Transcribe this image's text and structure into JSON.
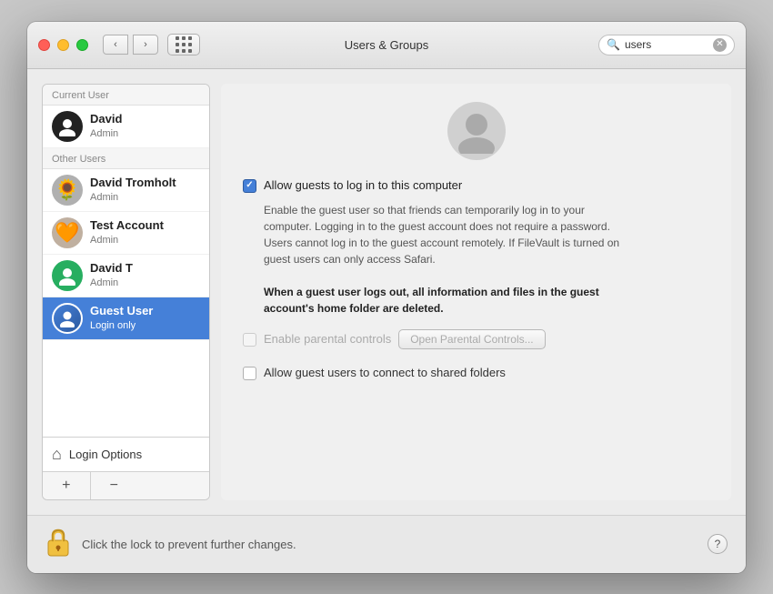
{
  "window": {
    "title": "Users & Groups"
  },
  "titlebar": {
    "back_label": "‹",
    "forward_label": "›",
    "search_value": "users",
    "search_placeholder": "Search"
  },
  "sidebar": {
    "current_user_header": "Current User",
    "other_users_header": "Other Users",
    "current_user": {
      "name": "David",
      "role": "Admin"
    },
    "other_users": [
      {
        "name": "David Tromholt",
        "role": "Admin",
        "avatar_type": "sunflower"
      },
      {
        "name": "Test Account",
        "role": "Admin",
        "avatar_type": "orange"
      },
      {
        "name": "David T",
        "role": "Admin",
        "avatar_type": "green"
      },
      {
        "name": "Guest User",
        "role": "Login only",
        "avatar_type": "guest",
        "selected": true
      }
    ],
    "login_options_label": "Login Options",
    "add_btn": "+",
    "remove_btn": "−"
  },
  "detail": {
    "allow_guests_label": "Allow guests to log in to this computer",
    "description": "Enable the guest user so that friends can temporarily log in to your computer. Logging in to the guest account does not require a password. Users cannot log in to the guest account remotely. If FileVault is turned on guest users can only access Safari.",
    "warning_text": "When a guest user logs out, all information and files in the guest account's home folder are deleted.",
    "parental_controls_label": "Enable parental controls",
    "open_parental_btn_label": "Open Parental Controls...",
    "shared_folders_label": "Allow guest users to connect to shared folders",
    "allow_guests_checked": true,
    "parental_controls_checked": false,
    "shared_folders_checked": false
  },
  "footer": {
    "lock_text": "Click the lock to prevent further changes.",
    "help_label": "?"
  }
}
